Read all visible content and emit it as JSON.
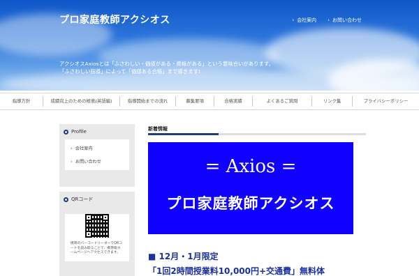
{
  "header": {
    "site_title": "プロ家庭教師アクシオス",
    "top_links": [
      {
        "label": "会社案内"
      },
      {
        "label": "お問い合わせ"
      }
    ],
    "tagline_line1": "アクシオスAxiosとは「ふさわしい・価値がある・資格がある」という意味合いがあります。",
    "tagline_line2": "「ふさわしい指導」によって「価値ある合格」まで導きます!"
  },
  "nav": {
    "items": [
      {
        "label": "指導方針"
      },
      {
        "label": "成績向上のための極意(英語編)"
      },
      {
        "label": "指導開始までの流れ"
      },
      {
        "label": "募集要項"
      },
      {
        "label": "合格実績"
      },
      {
        "label": "よくあるご質問"
      },
      {
        "label": "リンク集"
      },
      {
        "label": "プライバシーポリシー"
      }
    ]
  },
  "sidebar": {
    "profile_title": "Profile",
    "profile_links": [
      {
        "label": "会社案内"
      },
      {
        "label": "お問い合わせ"
      }
    ],
    "qr_title": "QRコード",
    "qr_text": "携帯のバーコードリーダーでQRコードを読み取ることで、携帯版ホームページへアクセスできます。"
  },
  "main": {
    "news_heading": "新着情報",
    "banner_line1": "= Axios =",
    "banner_line2": "プロ家庭教師アクシオス",
    "promo_line1": "■ 12月・1月限定",
    "promo_line2": "「1回2時間授業料10,000円+交通費」無料体"
  },
  "colors": {
    "nav_accent": "#1d3e7d",
    "banner_bg": "#0f00ff",
    "promo_text": "#1a2fa0"
  }
}
